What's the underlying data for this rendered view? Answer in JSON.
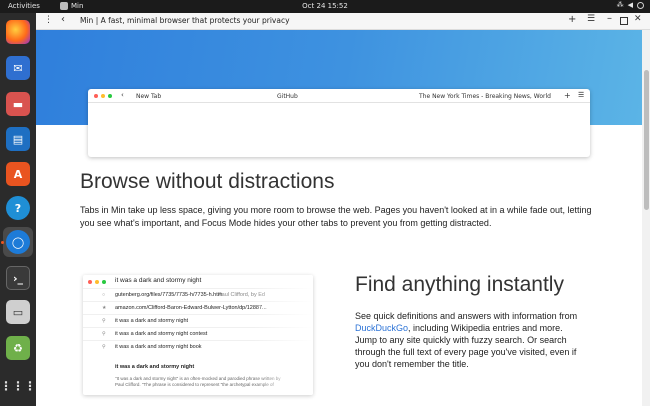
{
  "topbar": {
    "activities": "Activities",
    "app_name": "Min",
    "clock": "Oct 24  15:52"
  },
  "dock": {
    "items": [
      "firefox-icon",
      "thunderbird-icon",
      "files-icon",
      "writer-icon",
      "software-icon",
      "help-icon",
      "min-browser-icon",
      "terminal-icon",
      "save-icon",
      "trash-icon",
      "apps-grid-icon"
    ]
  },
  "browser": {
    "title": "Min | A fast, minimal browser that protects your privacy",
    "mock_tabs": [
      "New Tab",
      "GitHub",
      "The New York Times - Breaking News, World"
    ]
  },
  "section1": {
    "heading": "Browse without distractions",
    "body": "Tabs in Min take up less space, giving you more room to browse the web. Pages you haven't looked at in a while fade out, letting you see what's important, and Focus Mode hides your other tabs to prevent you from getting distracted."
  },
  "search_mock": {
    "query": "it was a dark and stormy night",
    "rows": [
      {
        "icon": "○",
        "text": "gutenberg.org/files/7735/7735-h/7735-h.htm",
        "sub": "Paul Clifford, by Ed"
      },
      {
        "icon": "★",
        "text": "amazon.com/Clifford-Baron-Edward-Bulwer-Lytton/dp/12887...",
        "sub": ""
      },
      {
        "icon": "⚲",
        "text": "it was a dark and stormy night",
        "sub": ""
      },
      {
        "icon": "⚲",
        "text": "it was a dark and stormy night contest",
        "sub": ""
      },
      {
        "icon": "⚲",
        "text": "it was a dark and stormy night book",
        "sub": ""
      },
      {
        "icon": "",
        "text": "it was a dark and stormy night",
        "sub": ""
      }
    ],
    "description": "\"It was a dark and stormy night\" is an often-mocked and parodied phrase written by\nPaul Clifford. \"The phrase is considered to represent \"the archetypal example of"
  },
  "section2": {
    "heading": "Find anything instantly",
    "body_before": "See quick definitions and answers with information from ",
    "link": "DuckDuckGo",
    "body_after": ", including Wikipedia entries and more. Jump to any site quickly with fuzzy search. Or search through the full text of every page you've visited, even if you don't remember the title."
  },
  "colors": {
    "hero_start": "#2f7fdc",
    "hero_end": "#5cb5e6",
    "link": "#2b72d6",
    "dock_bg": "#2b2b2b",
    "topbar_bg": "#1b1b1b"
  }
}
